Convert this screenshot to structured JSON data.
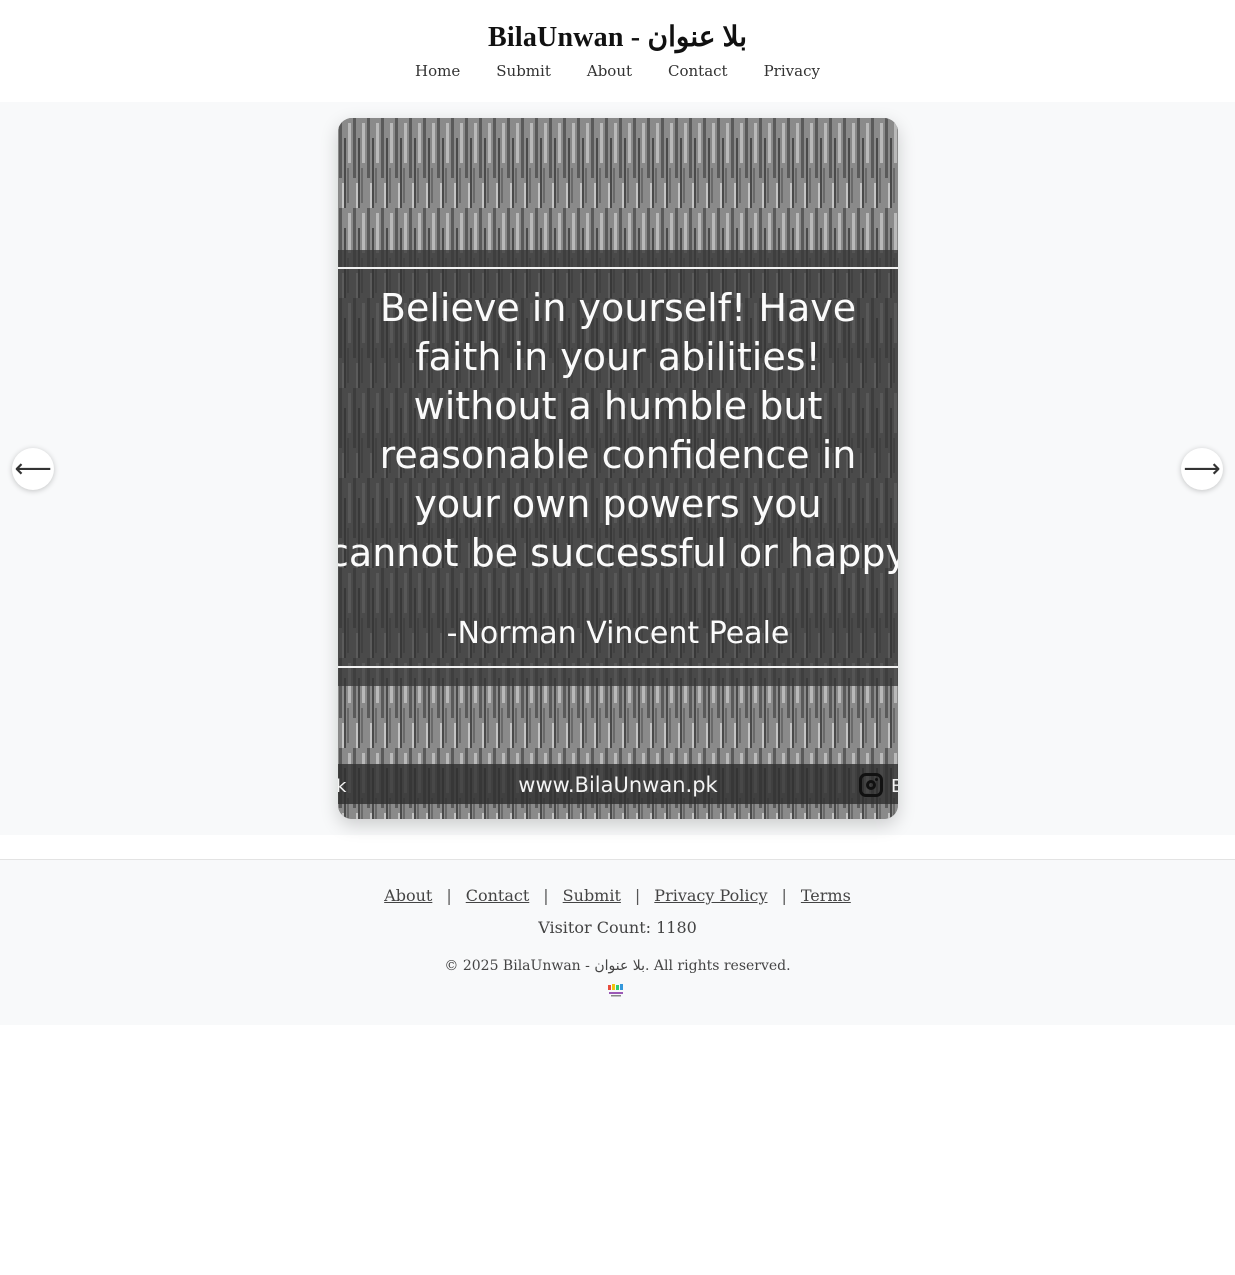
{
  "header": {
    "site_title": "BilaUnwan - بلا عنوان",
    "nav": [
      "Home",
      "Submit",
      "About",
      "Contact",
      "Privacy"
    ]
  },
  "carousel": {
    "quote_text": "Believe in yourself! Have\nfaith in your abilities!\nwithout a humble but\nreasonable confidence in\nyour own powers you\ncannot be successful or happy",
    "author": "-Norman Vincent Peale",
    "site_url": "www.BilaUnwan.pk",
    "footer_left_fragment": "k",
    "footer_right_fragment": "B",
    "prev_arrow": "⟵",
    "next_arrow": "⟶"
  },
  "footer": {
    "links": [
      "About",
      "Contact",
      "Submit",
      "Privacy Policy",
      "Terms"
    ],
    "separator": "|",
    "visitor_count_label": "Visitor Count: 1180",
    "copyright": "© 2025 BilaUnwan - بلا عنوان. All rights reserved."
  },
  "icons": {
    "instagram": "instagram-icon",
    "mini_logo": "site-logo-icon"
  },
  "colors": {
    "page_bg": "#ffffff",
    "stage_bg": "#f8f9fa",
    "text": "#333333"
  }
}
